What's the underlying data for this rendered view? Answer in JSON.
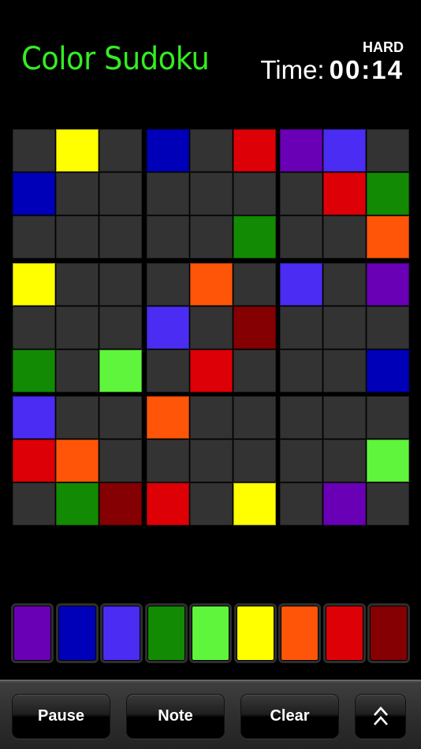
{
  "header": {
    "title": "Color Sudoku",
    "difficulty": "HARD",
    "time_label": "Time:",
    "time_value": "00:14"
  },
  "colors": {
    "empty": "#333333",
    "purple": "#6a00b5",
    "blue": "#0000b8",
    "violet": "#4a2cf2",
    "green": "#138a03",
    "lime": "#5ff53c",
    "yellow": "#ffff00",
    "orange": "#ff5508",
    "red": "#dd0006",
    "maroon": "#840003"
  },
  "board": [
    [
      "empty",
      "yellow",
      "empty",
      "blue",
      "empty",
      "red",
      "purple",
      "violet",
      "empty"
    ],
    [
      "blue",
      "empty",
      "empty",
      "empty",
      "empty",
      "empty",
      "empty",
      "red",
      "green"
    ],
    [
      "empty",
      "empty",
      "empty",
      "empty",
      "empty",
      "green",
      "empty",
      "empty",
      "orange"
    ],
    [
      "yellow",
      "empty",
      "empty",
      "empty",
      "orange",
      "empty",
      "violet",
      "empty",
      "purple"
    ],
    [
      "empty",
      "empty",
      "empty",
      "violet",
      "empty",
      "maroon",
      "empty",
      "empty",
      "empty"
    ],
    [
      "green",
      "empty",
      "lime",
      "empty",
      "red",
      "empty",
      "empty",
      "empty",
      "blue"
    ],
    [
      "violet",
      "empty",
      "empty",
      "orange",
      "empty",
      "empty",
      "empty",
      "empty",
      "empty"
    ],
    [
      "red",
      "orange",
      "empty",
      "empty",
      "empty",
      "empty",
      "empty",
      "empty",
      "lime"
    ],
    [
      "empty",
      "green",
      "maroon",
      "red",
      "empty",
      "yellow",
      "empty",
      "purple",
      "empty"
    ]
  ],
  "palette": [
    "purple",
    "blue",
    "violet",
    "green",
    "lime",
    "yellow",
    "orange",
    "red",
    "maroon"
  ],
  "toolbar": {
    "pause_label": "Pause",
    "note_label": "Note",
    "clear_label": "Clear",
    "expand_icon": "double-chevron-up-icon"
  }
}
